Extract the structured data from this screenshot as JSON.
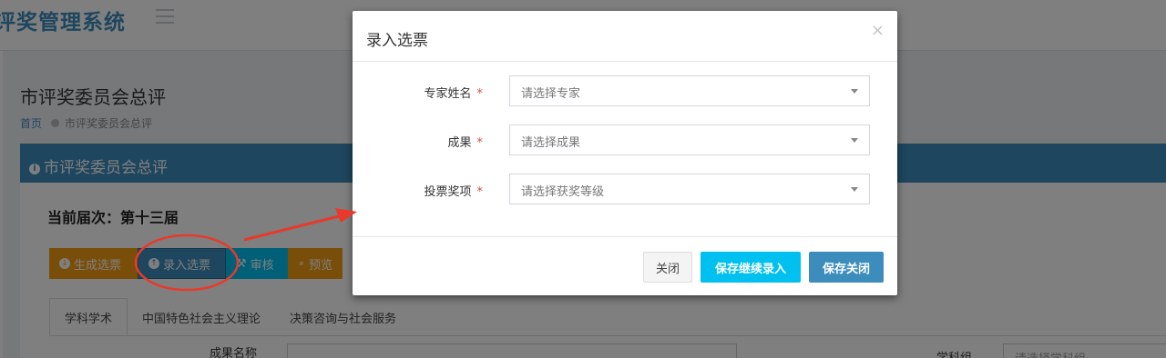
{
  "header": {
    "brand": "评奖管理系统",
    "menu_icon": "hamburger-icon"
  },
  "page": {
    "title": "市评奖委员会总评",
    "breadcrumb_home": "首页",
    "breadcrumb_current": "市评奖委员会总评"
  },
  "panel": {
    "header": "市评奖委员会总评",
    "session_label": "当前届次：第十三届",
    "buttons": [
      {
        "label": "生成选票",
        "icon": "download-icon"
      },
      {
        "label": "录入选票",
        "icon": "upload-icon"
      },
      {
        "label": "审核",
        "icon": "gavel-icon"
      },
      {
        "label": "预览",
        "icon": "search-icon"
      }
    ],
    "tabs": [
      "学科学术",
      "中国特色社会主义理论",
      "决策咨询与社会服务"
    ],
    "filter_label_1": "成果名称",
    "filter_label_2": "学科组",
    "filter_placeholder_2": "请选择学科组"
  },
  "modal": {
    "title": "录入选票",
    "close_glyph": "×",
    "fields": [
      {
        "label": "专家姓名",
        "required_mark": "*",
        "placeholder": "请选择专家"
      },
      {
        "label": "成果",
        "required_mark": "*",
        "placeholder": "请选择成果"
      },
      {
        "label": "投票奖项",
        "required_mark": "*",
        "placeholder": "请选择获奖等级"
      }
    ],
    "buttons": {
      "close": "关闭",
      "save_continue": "保存继续录入",
      "save_close": "保存关闭"
    }
  },
  "colors": {
    "primary": "#3c8dbc",
    "info": "#00c0ef",
    "warning": "#f39c12",
    "annotation": "#e8392b"
  }
}
